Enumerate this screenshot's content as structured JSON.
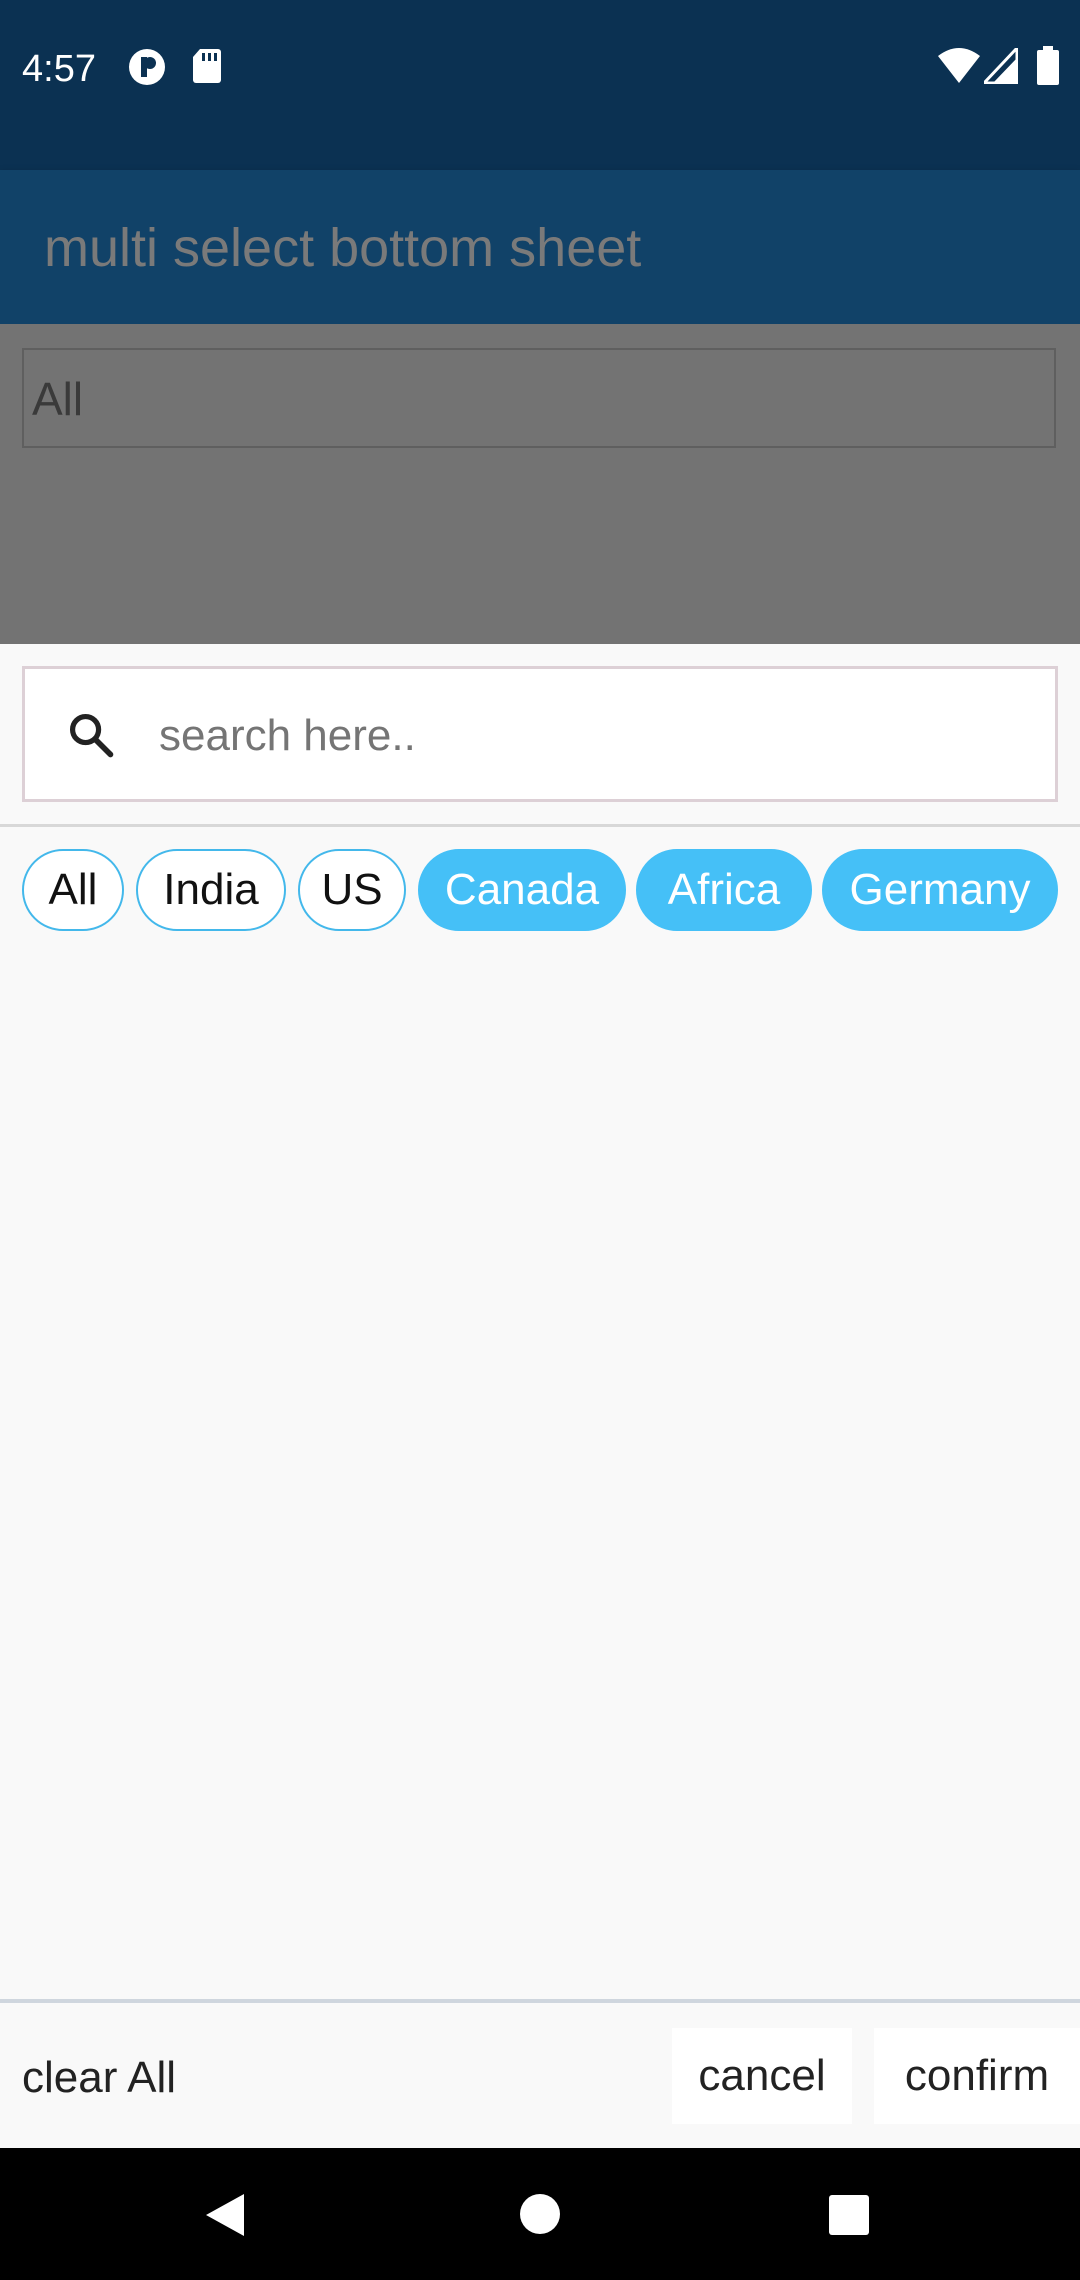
{
  "status_bar": {
    "time": "4:57",
    "left_icons": [
      "podcast-icon",
      "sd-card-icon"
    ],
    "right_icons": [
      "wifi-icon",
      "cell-signal-icon",
      "battery-icon"
    ]
  },
  "app_bar": {
    "title": "multi select bottom sheet"
  },
  "page": {
    "selected_value": "All"
  },
  "sheet": {
    "search": {
      "placeholder": "search here..",
      "value": ""
    },
    "chips": [
      {
        "label": "All",
        "selected": false
      },
      {
        "label": "India",
        "selected": false
      },
      {
        "label": "US",
        "selected": false
      },
      {
        "label": "Canada",
        "selected": true
      },
      {
        "label": "Africa",
        "selected": true
      },
      {
        "label": "Germany",
        "selected": true
      }
    ],
    "actions": {
      "clear_all": "clear All",
      "cancel": "cancel",
      "confirm": "confirm"
    }
  },
  "nav_bar": {
    "icons": [
      "back-icon",
      "home-icon",
      "recents-icon"
    ]
  },
  "colors": {
    "status_bar": "#0b3152",
    "app_bar": "#114268",
    "chip_selected": "#45c0f7",
    "chip_border": "#43b8eb",
    "scrim": "#737373"
  }
}
